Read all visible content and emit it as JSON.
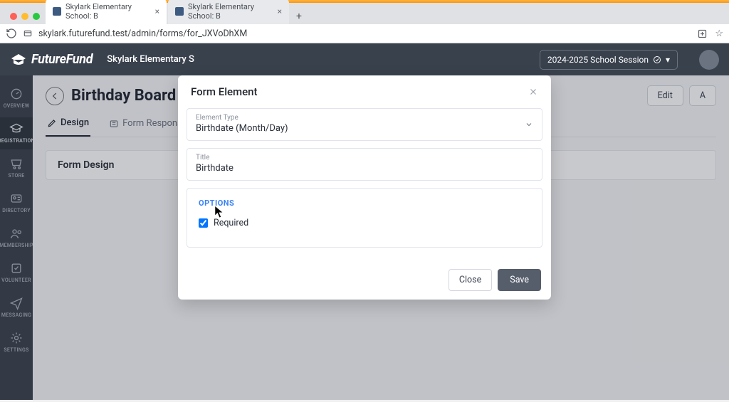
{
  "browser": {
    "tabs": [
      {
        "title": "Skylark Elementary School: B",
        "active": true
      },
      {
        "title": "Skylark Elementary School: B",
        "active": false
      }
    ],
    "url": "skylark.futurefund.test/admin/forms/for_JXVoDhXM"
  },
  "header": {
    "brand": "FutureFund",
    "school": "Skylark Elementary S",
    "session": "2024-2025 School Session"
  },
  "sidebar": {
    "items": [
      {
        "label": "OVERVIEW"
      },
      {
        "label": "REGISTRATION"
      },
      {
        "label": "STORE"
      },
      {
        "label": "DIRECTORY"
      },
      {
        "label": "MEMBERSHIP"
      },
      {
        "label": "VOLUNTEER"
      },
      {
        "label": "MESSAGING"
      },
      {
        "label": "SETTINGS"
      }
    ]
  },
  "page": {
    "title": "Birthday Board",
    "actions": {
      "edit": "Edit",
      "add": "A"
    },
    "tabs": [
      {
        "label": "Design",
        "active": true
      },
      {
        "label": "Form Responses",
        "active": false
      },
      {
        "label": "",
        "active": false
      }
    ],
    "design_card_title": "Form Design"
  },
  "modal": {
    "title": "Form Element",
    "element_type_label": "Element Type",
    "element_type_value": "Birthdate (Month/Day)",
    "title_field_label": "Title",
    "title_field_value": "Birthdate",
    "options_heading": "OPTIONS",
    "required_label": "Required",
    "required_checked": true,
    "close_btn": "Close",
    "save_btn": "Save"
  }
}
